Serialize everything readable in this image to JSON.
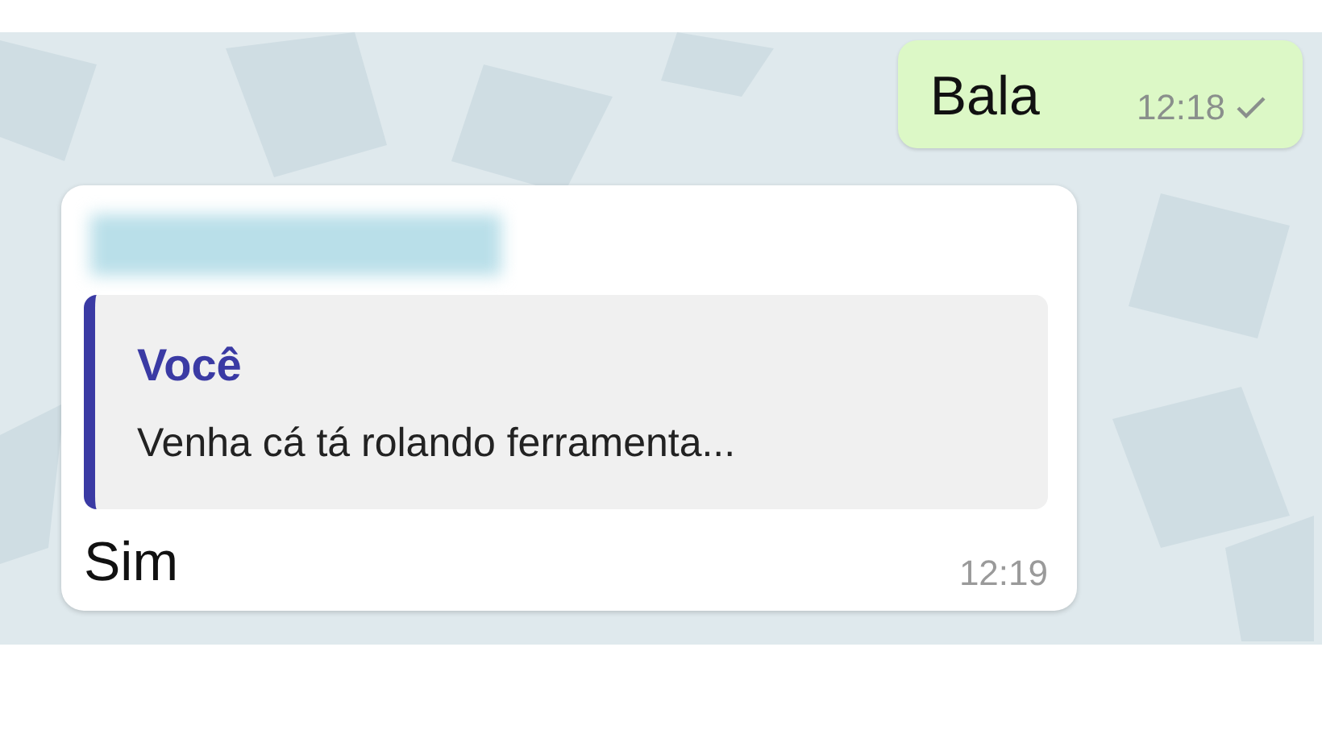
{
  "messages": [
    {
      "kind": "outgoing",
      "text": "Bala",
      "time": "12:18",
      "delivered": true
    },
    {
      "kind": "incoming",
      "sender_hidden": true,
      "quote": {
        "author": "Você",
        "text": "Venha cá tá rolando ferramenta..."
      },
      "text": "Sim",
      "time": "12:19"
    }
  ]
}
